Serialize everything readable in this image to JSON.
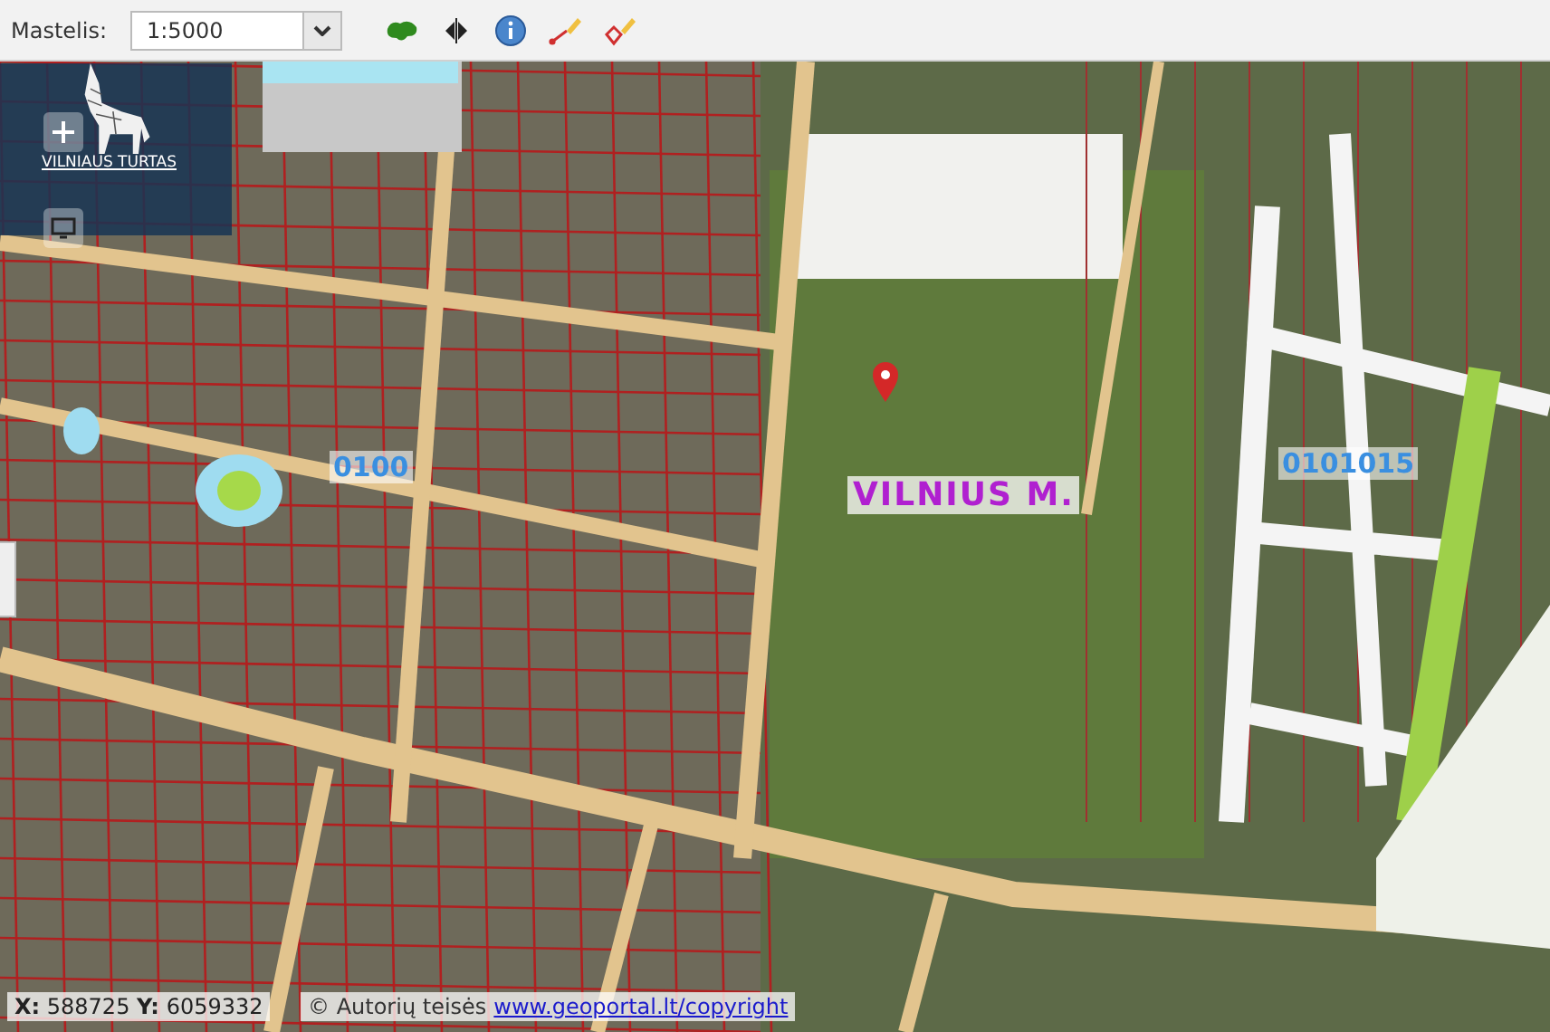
{
  "toolbar": {
    "scale_label": "Mastelis:",
    "scale_value": "1:5000"
  },
  "logo": {
    "text": "VILNIAUS TURTAS"
  },
  "map": {
    "labels": [
      {
        "text": "0100",
        "kind": "cadastral"
      },
      {
        "text": "VILNIUS M.",
        "kind": "city"
      },
      {
        "text": "0101015",
        "kind": "cadastral"
      }
    ]
  },
  "coordinates": {
    "x_label": "X:",
    "x_value": "588725",
    "y_label": "Y:",
    "y_value": "6059332"
  },
  "copyright": {
    "text": "© Autorių teisės",
    "link": "www.geoportal.lt/copyright"
  }
}
